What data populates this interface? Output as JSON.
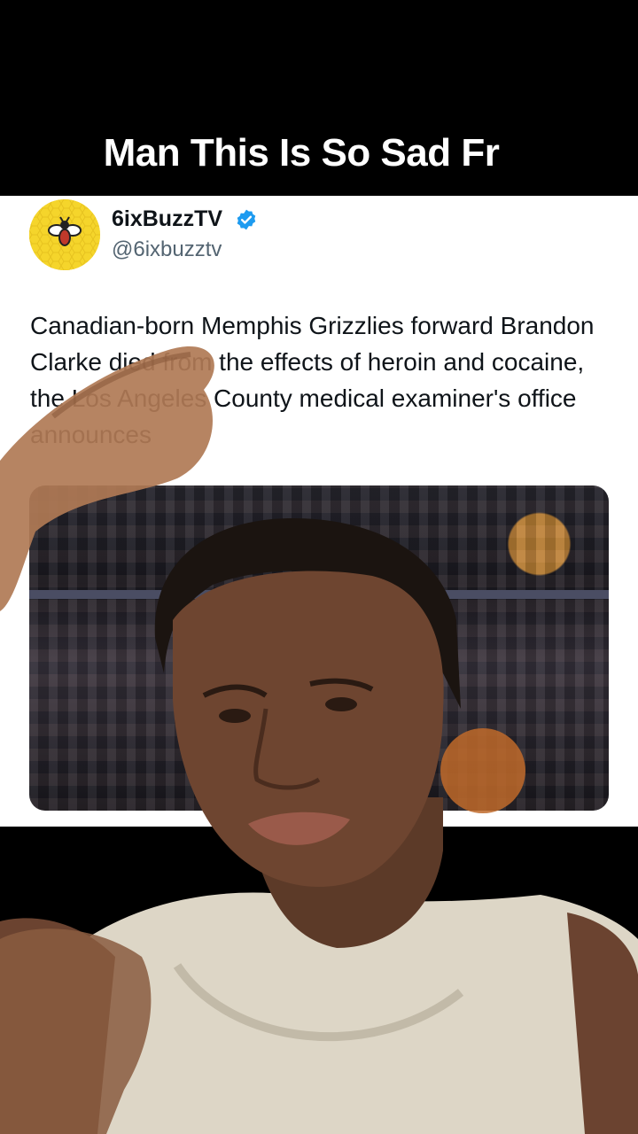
{
  "video": {
    "caption": "Man This Is So Sad Fr"
  },
  "tweet": {
    "display_name": "6ixBuzzTV",
    "handle": "@6ixbuzztv",
    "verified": true,
    "text": "Canadian-born Memphis Grizzlies forward Brandon Clarke died from the effects of heroin and cocaine, the Los Angeles County medical examiner's office announces",
    "emoji": "😳",
    "avatar_icon": "bee-logo-icon",
    "media_icon": "basketball-arena-photo"
  },
  "colors": {
    "caption_text": "#ffffff",
    "band": "#000000",
    "card_bg": "#ffffff",
    "name_text": "#0f1419",
    "handle_text": "#536471",
    "verified_blue": "#1d9bf0",
    "avatar_yellow": "#f5d52b"
  }
}
